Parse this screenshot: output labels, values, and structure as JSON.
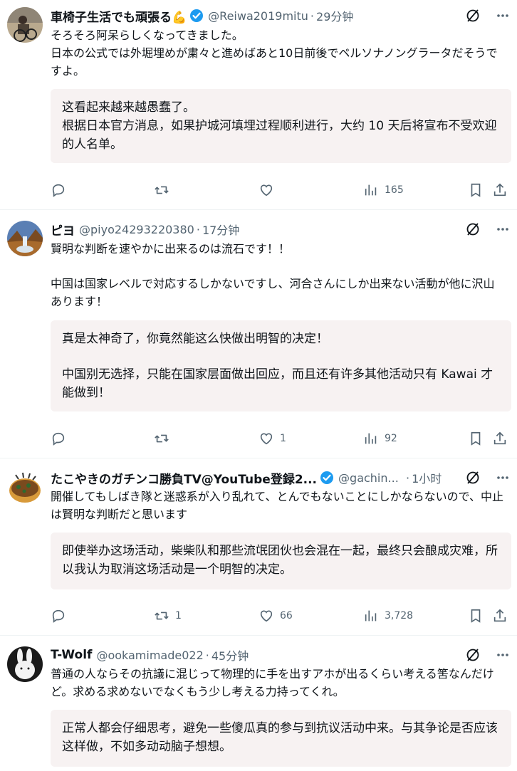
{
  "tweets": [
    {
      "name": "車椅子生活でも頑張る💪",
      "handle": "@Reiwa2019mitu",
      "time": "29分钟",
      "verified": true,
      "text": [
        "そろそろ阿呆らしくなってきました。",
        "日本の公式では外堀埋めが粛々と進めばあと10日前後でペルソナノングラータだそうですよ。"
      ],
      "translation": [
        "这看起来越来越愚蠢了。",
        "根据日本官方消息，如果护城河填埋过程顺利进行，大约 10 天后将宣布不受欢迎的人名单。"
      ],
      "stats": {
        "reply": "",
        "retweet": "",
        "like": "",
        "views": "165"
      }
    },
    {
      "name": "ピヨ",
      "handle": "@piyo24293220380",
      "time": "17分钟",
      "verified": false,
      "text": [
        "賢明な判断を速やかに出来るのは流石です！！",
        "",
        "中国は国家レベルで対応するしかないですし、河合さんにしか出来ない活動が他に沢山あります！"
      ],
      "translation": [
        "真是太神奇了，你竟然能这么快做出明智的决定！",
        "",
        "中国别无选择，只能在国家层面做出回应，而且还有许多其他活动只有 Kawai 才能做到！"
      ],
      "stats": {
        "reply": "",
        "retweet": "",
        "like": "1",
        "views": "92"
      }
    },
    {
      "name": "たこやきのガチンコ勝負TV@YouTube登録2...",
      "handle": "@gachin...",
      "time": "1小时",
      "verified": true,
      "text": [
        "開催してもしばき隊と迷惑系が入り乱れて、とんでもないことにしかならないので、中止は賢明な判断だと思います"
      ],
      "translation": [
        "即使举办这场活动，柴柴队和那些流氓团伙也会混在一起，最终只会酿成灾难，所以我认为取消这场活动是一个明智的决定。"
      ],
      "stats": {
        "reply": "",
        "retweet": "1",
        "like": "66",
        "views": "3,728"
      }
    },
    {
      "name": "T-Wolf",
      "handle": "@ookamimade022",
      "time": "45分钟",
      "verified": false,
      "text": [
        "普通の人ならその抗議に混じって物理的に手を出すアホが出るくらい考える筈なんだけど。求める求めないでなくもう少し考える力持ってくれ。"
      ],
      "translation": [
        "正常人都会仔细思考，避免一些傻瓜真的参与到抗议活动中来。与其争论是否应该这样做，不如多动动脑子想想。"
      ],
      "stats": {}
    }
  ],
  "colors": {
    "verified": "#1d9bf0",
    "muted": "#536471",
    "translation_bg": "#f7f2f2"
  }
}
